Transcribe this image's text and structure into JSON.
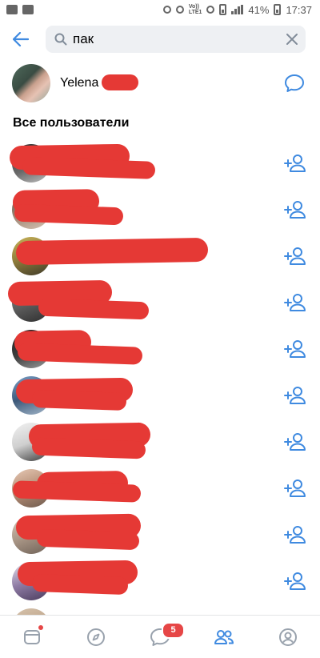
{
  "status_bar": {
    "battery": "41%",
    "time": "17:37",
    "network": "LTE1",
    "volte": "Vo))"
  },
  "search": {
    "query": "пак"
  },
  "top_result": {
    "name": "Yelena"
  },
  "section": {
    "all_users": "Все пользователи"
  },
  "users_count": 10,
  "bottom_nav": {
    "messages_badge": "5",
    "active_tab": "friends"
  },
  "colors": {
    "accent": "#3f8ae0",
    "nav_icon": "#99a2ad",
    "badge": "#e64646",
    "redaction": "#e53935"
  },
  "icons": {
    "back": "arrow-left-icon",
    "search": "search-icon",
    "clear": "close-icon",
    "message": "message-bubble-icon",
    "add_friend": "add-user-icon",
    "nav": [
      "newsfeed-icon",
      "discover-icon",
      "messages-icon",
      "friends-icon",
      "profile-icon"
    ]
  }
}
